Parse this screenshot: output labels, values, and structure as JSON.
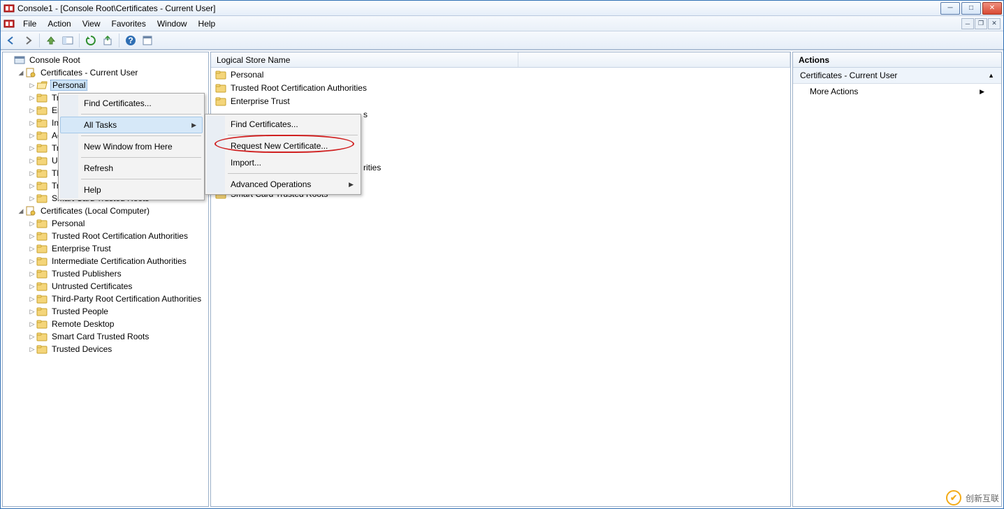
{
  "title": "Console1 - [Console Root\\Certificates - Current User]",
  "menus": [
    "File",
    "Action",
    "View",
    "Favorites",
    "Window",
    "Help"
  ],
  "tree": {
    "root": "Console Root",
    "cert_cu": "Certificates - Current User",
    "cu_items": [
      "Personal",
      "Tr",
      "Er",
      "In",
      "Ac",
      "Tr",
      "Ur",
      "Th",
      "Tr",
      "Smart Card Trusted Roots"
    ],
    "cert_lc": "Certificates (Local Computer)",
    "lc_items": [
      "Personal",
      "Trusted Root Certification Authorities",
      "Enterprise Trust",
      "Intermediate Certification Authorities",
      "Trusted Publishers",
      "Untrusted Certificates",
      "Third-Party Root Certification Authorities",
      "Trusted People",
      "Remote Desktop",
      "Smart Card Trusted Roots",
      "Trusted Devices"
    ]
  },
  "list": {
    "header": "Logical Store Name",
    "rows": [
      "Personal",
      "Trusted Root Certification Authorities",
      "Enterprise Trust",
      "s",
      "rities",
      "Smart Card Trusted Roots"
    ]
  },
  "actions": {
    "title": "Actions",
    "section": "Certificates - Current User",
    "more": "More Actions"
  },
  "ctx1": {
    "find": "Find Certificates...",
    "alltasks": "All Tasks",
    "newwin": "New Window from Here",
    "refresh": "Refresh",
    "help": "Help"
  },
  "ctx2": {
    "find": "Find Certificates...",
    "request": "Request New Certificate...",
    "import": "Import...",
    "adv": "Advanced Operations"
  },
  "watermark": "创新互联"
}
